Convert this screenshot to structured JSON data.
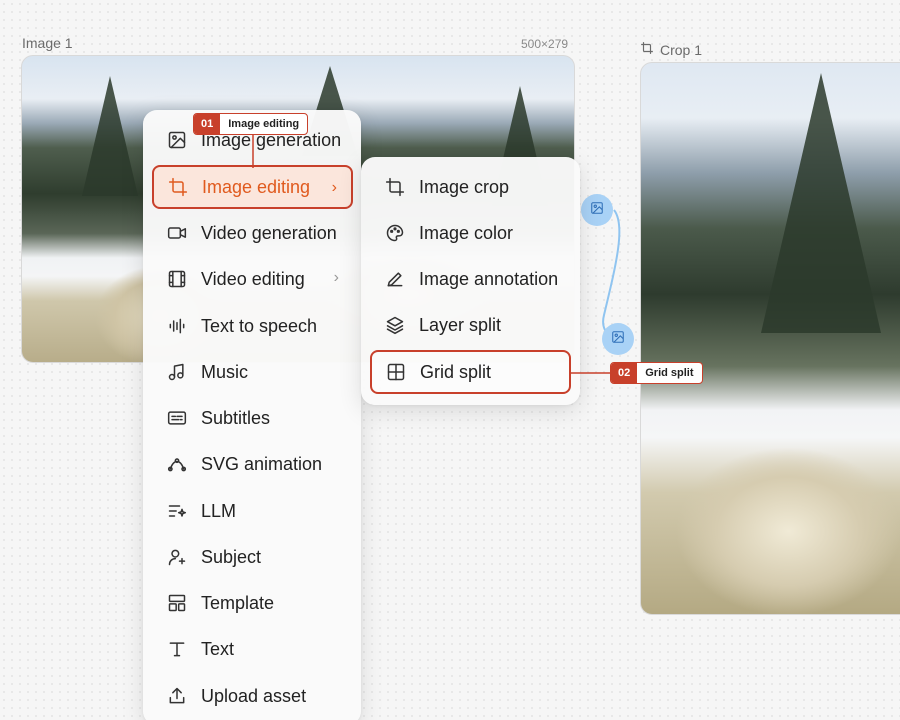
{
  "nodes": {
    "image1": {
      "title": "Image 1",
      "dimensions": "500×279"
    },
    "crop1": {
      "title": "Crop 1"
    }
  },
  "main_menu": {
    "items": [
      {
        "label": "Image generation",
        "icon": "image-icon"
      },
      {
        "label": "Image editing",
        "icon": "crop-icon",
        "has_submenu": true,
        "active": true
      },
      {
        "label": "Video generation",
        "icon": "video-icon"
      },
      {
        "label": "Video editing",
        "icon": "film-icon",
        "has_submenu": true
      },
      {
        "label": "Text to speech",
        "icon": "waveform-icon"
      },
      {
        "label": "Music",
        "icon": "music-icon"
      },
      {
        "label": "Subtitles",
        "icon": "subtitles-icon"
      },
      {
        "label": "SVG animation",
        "icon": "bezier-icon"
      },
      {
        "label": "LLM",
        "icon": "llm-icon"
      },
      {
        "label": "Subject",
        "icon": "subject-icon"
      },
      {
        "label": "Template",
        "icon": "template-icon"
      },
      {
        "label": "Text",
        "icon": "text-icon"
      },
      {
        "label": "Upload asset",
        "icon": "upload-icon"
      }
    ]
  },
  "sub_menu": {
    "items": [
      {
        "label": "Image crop",
        "icon": "crop-icon"
      },
      {
        "label": "Image color",
        "icon": "palette-icon"
      },
      {
        "label": "Image annotation",
        "icon": "pen-icon"
      },
      {
        "label": "Layer split",
        "icon": "layers-icon"
      },
      {
        "label": "Grid split",
        "icon": "grid-icon",
        "highlighted": true
      }
    ]
  },
  "callouts": [
    {
      "num": "01",
      "label": "Image editing"
    },
    {
      "num": "02",
      "label": "Grid split"
    }
  ],
  "chevron": "›",
  "colors": {
    "accent": "#e05a1e",
    "callout": "#c8402b",
    "handle": "#a9d2f6"
  }
}
